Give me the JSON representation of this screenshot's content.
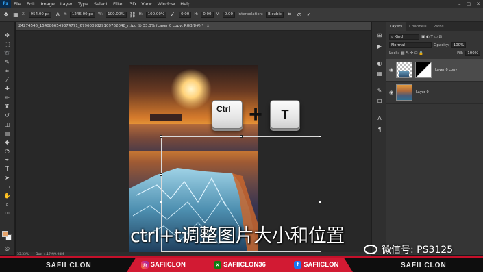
{
  "menubar": {
    "logo": "Ps",
    "items": [
      "File",
      "Edit",
      "Image",
      "Layer",
      "Type",
      "Select",
      "Filter",
      "3D",
      "View",
      "Window",
      "Help"
    ],
    "window_controls": [
      "–",
      "□",
      "✕"
    ]
  },
  "options": {
    "x_label": "X:",
    "x_value": "954.00 px",
    "y_label": "Y:",
    "y_value": "1246.00 px",
    "w_label": "W:",
    "w_value": "100.00%",
    "h_label": "H:",
    "h_value": "100.00%",
    "angle_value": "0.00",
    "hskew_label": "H:",
    "hskew_value": "0.00",
    "vskew_label": "V:",
    "vskew_value": "0.00",
    "interp_label": "Interpolation:",
    "interp_value": "Bicubic"
  },
  "document": {
    "tab_title": "24274546_1540866549374771_6796009829109762048_n.jpg @ 33.3% (Layer 0 copy, RGB/8#) *",
    "close": "×",
    "zoom": "33.33%",
    "doc_size": "Doc: 4.17M/9.98M"
  },
  "overlay": {
    "key_ctrl": "Ctrl",
    "plus": "+",
    "key_t": "T",
    "subtitle": "ctrl+t调整图片大小和位置",
    "wechat": "微信号: PS3125"
  },
  "layers_panel": {
    "tabs": [
      "Layers",
      "Channels",
      "Paths"
    ],
    "active_tab": "Layers",
    "kind": "Kind",
    "blend_mode": "Normal",
    "opacity_label": "Opacity:",
    "opacity_value": "100%",
    "lock_label": "Lock:",
    "fill_label": "Fill:",
    "fill_value": "100%",
    "layers": [
      {
        "name": "Layer 0 copy",
        "selected": true
      },
      {
        "name": "Layer 0",
        "selected": false
      }
    ]
  },
  "banner": {
    "left": "SAFII CLON",
    "instagram": "SAFIICLON",
    "xbox": "SAFIICLON36",
    "facebook": "SAFIICLON",
    "right": "SAFII CLON"
  },
  "colors": {
    "accent_red": "#d21a33",
    "foreground_swatch": "#e6a36a",
    "background_swatch": "#f3f3f3"
  }
}
